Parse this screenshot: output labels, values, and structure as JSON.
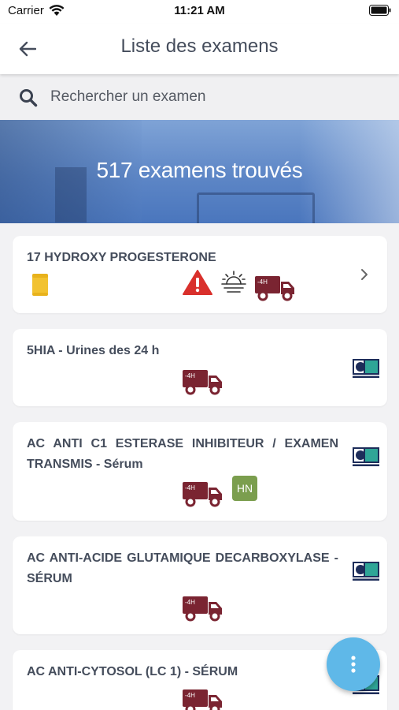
{
  "status_bar": {
    "carrier": "Carrier",
    "time": "11:21 AM"
  },
  "nav": {
    "title": "Liste des examens",
    "back_icon": "arrow-left-icon"
  },
  "search": {
    "placeholder": "Rechercher un examen",
    "value": ""
  },
  "banner": {
    "text": "517 examens trouvés"
  },
  "exams": [
    {
      "name": "17 HYDROXY PROGESTERONE",
      "icons": [
        "yellow-tube-icon",
        "warning-icon",
        "sunrise-icon",
        "truck-4h-icon"
      ],
      "has_chevron": true
    },
    {
      "name": "5HIA - Urines des 24 h",
      "icons": [
        "truck-4h-icon",
        "lab-transmit-icon"
      ]
    },
    {
      "name": "AC ANTI C1 ESTERASE INHIBITEUR / EXAMEN TRANSMIS - Sérum",
      "icons": [
        "truck-4h-icon",
        "hn-badge",
        "lab-transmit-icon"
      ],
      "badge": "HN"
    },
    {
      "name": "AC ANTI-ACIDE GLUTAMIQUE DECARBOXYLASE - SÉRUM",
      "icons": [
        "truck-4h-icon",
        "lab-transmit-icon"
      ]
    },
    {
      "name": "AC ANTI-CYTOSOL (LC 1) - SÉRUM",
      "icons": [
        "truck-4h-icon",
        "lab-transmit-icon"
      ]
    }
  ],
  "truck_label": "-4H",
  "colors": {
    "accent": "#5fb8e8",
    "truck": "#7a2431",
    "warning": "#d9302c",
    "badge": "#7b9e4e",
    "transmit_teal": "#2fa597",
    "transmit_navy": "#1d2d5a"
  }
}
